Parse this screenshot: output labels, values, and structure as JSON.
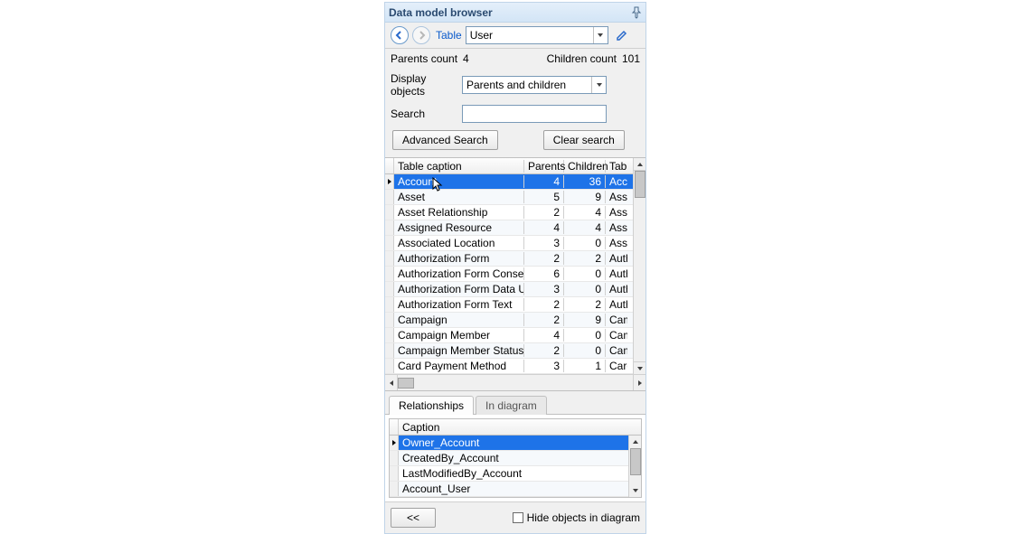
{
  "title": "Data model browser",
  "toolbar": {
    "table_label": "Table",
    "table_value": "User"
  },
  "meta": {
    "parents_count_label": "Parents count",
    "parents_count": "4",
    "children_count_label": "Children count",
    "children_count": "101"
  },
  "display_objects": {
    "label": "Display objects",
    "value": "Parents and children"
  },
  "search": {
    "label": "Search",
    "value": ""
  },
  "buttons": {
    "advanced_search": "Advanced Search",
    "clear_search": "Clear search",
    "back": "<<"
  },
  "columns": {
    "caption": "Table caption",
    "parents": "Parents",
    "children": "Children",
    "extra": "Tabl"
  },
  "rows": [
    {
      "caption": "Account",
      "parents": "4",
      "children": "36",
      "extra": "Acco",
      "selected": true
    },
    {
      "caption": "Asset",
      "parents": "5",
      "children": "9",
      "extra": "Asse"
    },
    {
      "caption": "Asset Relationship",
      "parents": "2",
      "children": "4",
      "extra": "Asse"
    },
    {
      "caption": "Assigned Resource",
      "parents": "4",
      "children": "4",
      "extra": "Assi"
    },
    {
      "caption": "Associated Location",
      "parents": "3",
      "children": "0",
      "extra": "Asso"
    },
    {
      "caption": "Authorization Form",
      "parents": "2",
      "children": "2",
      "extra": "Auth"
    },
    {
      "caption": "Authorization Form Consent",
      "parents": "6",
      "children": "0",
      "extra": "Auth"
    },
    {
      "caption": "Authorization Form Data Use",
      "parents": "3",
      "children": "0",
      "extra": "Auth"
    },
    {
      "caption": "Authorization Form Text",
      "parents": "2",
      "children": "2",
      "extra": "Auth"
    },
    {
      "caption": "Campaign",
      "parents": "2",
      "children": "9",
      "extra": "Cam"
    },
    {
      "caption": "Campaign Member",
      "parents": "4",
      "children": "0",
      "extra": "Cam"
    },
    {
      "caption": "Campaign Member Status",
      "parents": "2",
      "children": "0",
      "extra": "Cam"
    },
    {
      "caption": "Card Payment Method",
      "parents": "3",
      "children": "1",
      "extra": "Card"
    }
  ],
  "tabs": {
    "relationships": "Relationships",
    "in_diagram": "In diagram"
  },
  "detail": {
    "column": "Caption",
    "rows": [
      {
        "caption": "Owner_Account",
        "selected": true
      },
      {
        "caption": "CreatedBy_Account"
      },
      {
        "caption": "LastModifiedBy_Account"
      },
      {
        "caption": "Account_User"
      }
    ]
  },
  "footer": {
    "hide_label": "Hide objects in diagram",
    "hide_checked": false
  }
}
